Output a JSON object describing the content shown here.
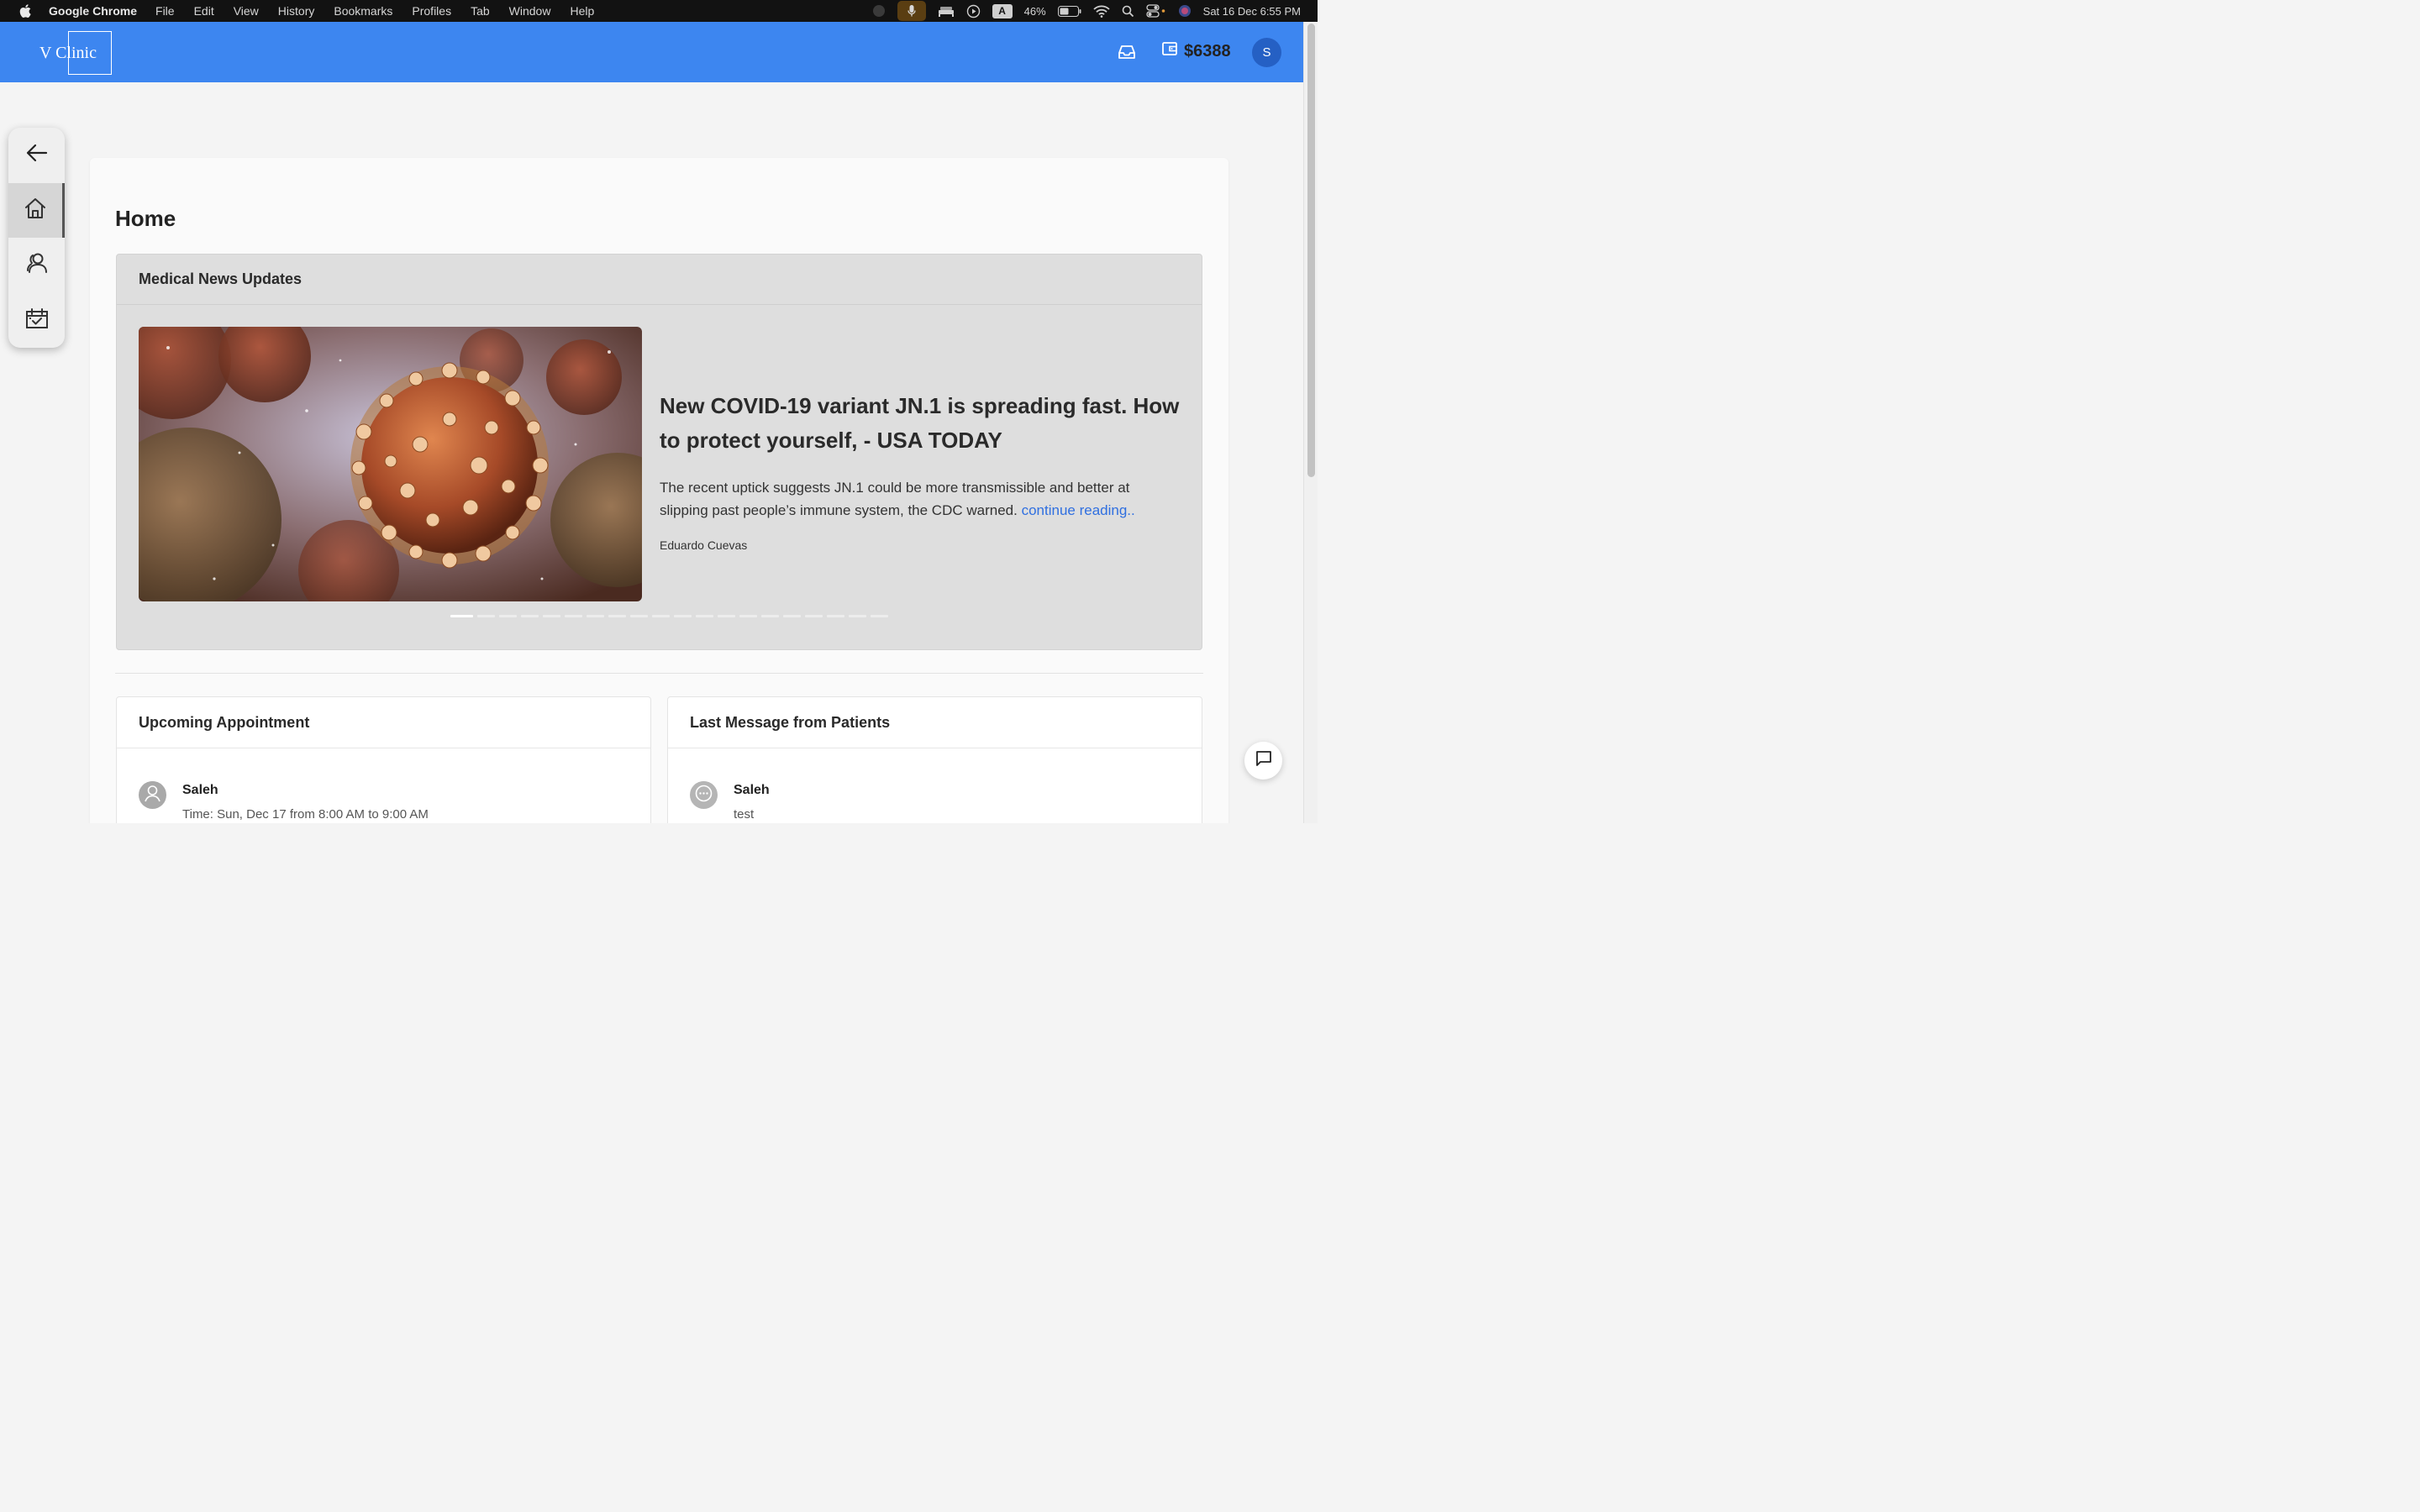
{
  "menubar": {
    "app_name": "Google Chrome",
    "items": [
      "File",
      "Edit",
      "View",
      "History",
      "Bookmarks",
      "Profiles",
      "Tab",
      "Window",
      "Help"
    ],
    "battery": "46%",
    "datetime": "Sat 16 Dec  6:55 PM",
    "input_indicator": "A"
  },
  "header": {
    "logo": "V Clinic",
    "balance": "$6388",
    "avatar_initial": "S",
    "accent_color": "#3d86f0"
  },
  "sidebar": {
    "items": [
      {
        "icon": "arrow-left-icon"
      },
      {
        "icon": "home-icon",
        "active": true
      },
      {
        "icon": "patients-icon"
      },
      {
        "icon": "calendar-check-icon"
      }
    ]
  },
  "page": {
    "title": "Home"
  },
  "news": {
    "header": "Medical News Updates",
    "article": {
      "image_alt": "coronavirus illustration",
      "title": "New COVID-19 variant JN.1 is spreading fast. How to protect yourself, - USA TODAY",
      "summary": "The recent uptick suggests JN.1 could be more transmissible and better at slipping past people’s immune system, the CDC warned.",
      "link_text": "continue reading..",
      "author": "Eduardo Cuevas"
    },
    "carousel": {
      "total": 20,
      "active_index": 0
    }
  },
  "appointments": {
    "header": "Upcoming Appointment",
    "items": [
      {
        "name": "Saleh",
        "time": "Time: Sun, Dec 17 from 8:00 AM to 9:00 AM"
      }
    ]
  },
  "messages": {
    "header": "Last Message from Patients",
    "items": [
      {
        "name": "Saleh",
        "message": "test"
      }
    ]
  }
}
